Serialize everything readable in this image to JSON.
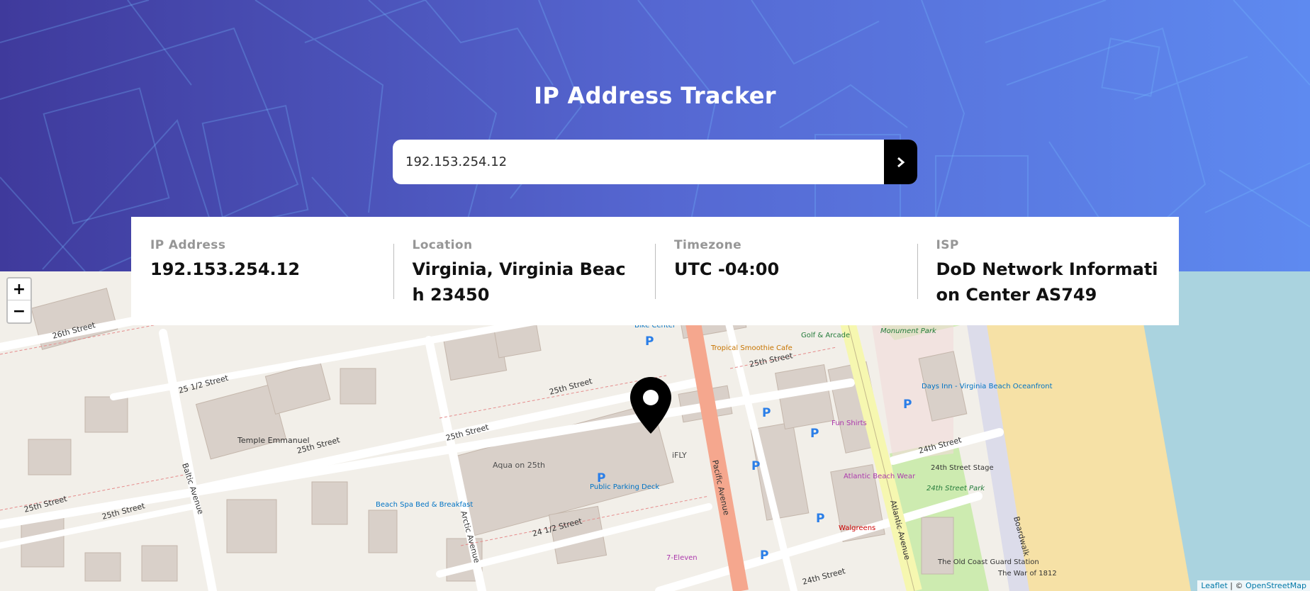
{
  "header": {
    "title": "IP Address Tracker",
    "search_value": "192.153.254.12",
    "submit_icon": "chevron-right-icon"
  },
  "info": {
    "ip": {
      "label": "IP Address",
      "value": "192.153.254.12"
    },
    "location": {
      "label": "Location",
      "value": "Virginia, Virginia Beach 23450"
    },
    "timezone": {
      "label": "Timezone",
      "value": "UTC -04:00"
    },
    "isp": {
      "label": "ISP",
      "value": "DoD Network Information Center AS749"
    }
  },
  "map": {
    "zoom_in": "+",
    "zoom_out": "−",
    "attribution_leaflet": "Leaflet",
    "attribution_sep": " | © ",
    "attribution_osm": "OpenStreetMap",
    "marker_icon": "location-pin-icon",
    "labels": {
      "street_26th": "26th Street",
      "street_25_half": "25 1/2 Street",
      "street_25th_a": "25th Street",
      "street_25th_b": "25th Street",
      "street_25th_c": "25th Street",
      "street_25th_d": "25th Street",
      "street_25th_e": "25th Street",
      "street_25th_f": "25th Street",
      "street_24_half": "24 1/2 Street",
      "street_24th_a": "24th Street",
      "street_24th_b": "24th Street",
      "baltic": "Baltic Avenue",
      "arctic": "Arctic Avenue",
      "pacific": "Pacific Avenue",
      "atlantic": "Atlantic Avenue",
      "boardwalk": "Boardwalk",
      "temple": "Temple Emmanuel",
      "aqua": "Aqua on 25th",
      "public_parking": "Public Parking Deck",
      "ifly": "iFLY",
      "beach_spa": "Beach Spa Bed & Breakfast",
      "seven_eleven": "7-Eleven",
      "tropical": "Tropical Smoothie Cafe",
      "fun_shirts": "Fun Shirts",
      "atlantic_wear": "Atlantic Beach Wear",
      "walgreens": "Walgreens",
      "days_inn": "Days Inn - Virginia Beach Oceanfront",
      "stage": "24th Street Stage",
      "park": "24th Street Park",
      "coast_guard": "The Old Coast Guard Station",
      "war_1812": "The War of 1812",
      "monument_park": "Monument Park",
      "golf": "Golf & Arcade",
      "bike_center": "Bike Center"
    }
  }
}
